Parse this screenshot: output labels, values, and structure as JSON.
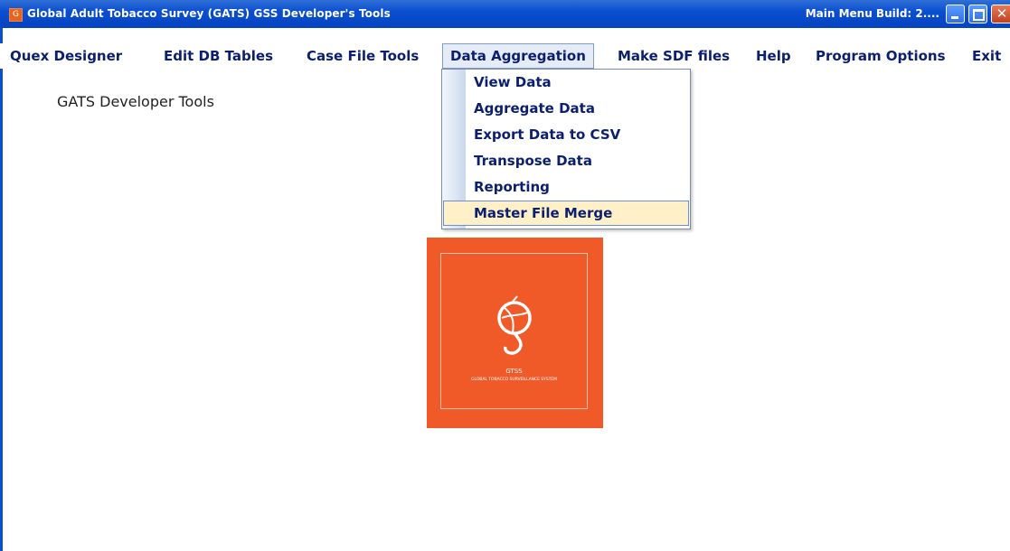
{
  "window": {
    "title": "Global Adult Tobacco Survey (GATS) GSS Developer's Tools",
    "build_label": "Main Menu Build: 2....",
    "icon_char": "G"
  },
  "menubar": {
    "items": [
      {
        "label": "Quex Designer"
      },
      {
        "label": "Edit DB Tables"
      },
      {
        "label": "Case File Tools"
      },
      {
        "label": "Data Aggregation"
      },
      {
        "label": "Make SDF files"
      },
      {
        "label": "Help"
      },
      {
        "label": "Program Options"
      },
      {
        "label": "Exit"
      }
    ],
    "open_menu": "Data Aggregation"
  },
  "dropdown": {
    "items": [
      {
        "label": "View Data"
      },
      {
        "label": "Aggregate Data"
      },
      {
        "label": "Export Data to CSV"
      },
      {
        "label": "Transpose Data"
      },
      {
        "label": "Reporting"
      },
      {
        "label": "Master File Merge"
      }
    ],
    "highlighted": "Master File Merge"
  },
  "main": {
    "title": "GATS Developer Tools"
  },
  "logo": {
    "acronym": "GTSS",
    "full_name": "GLOBAL TOBACCO SURVEILLANCE SYSTEM"
  },
  "colors": {
    "titlebar": "#0a4fd0",
    "menu_text": "#0b1f6e",
    "logo_bg": "#f05a28",
    "highlight": "#fff0c8"
  }
}
